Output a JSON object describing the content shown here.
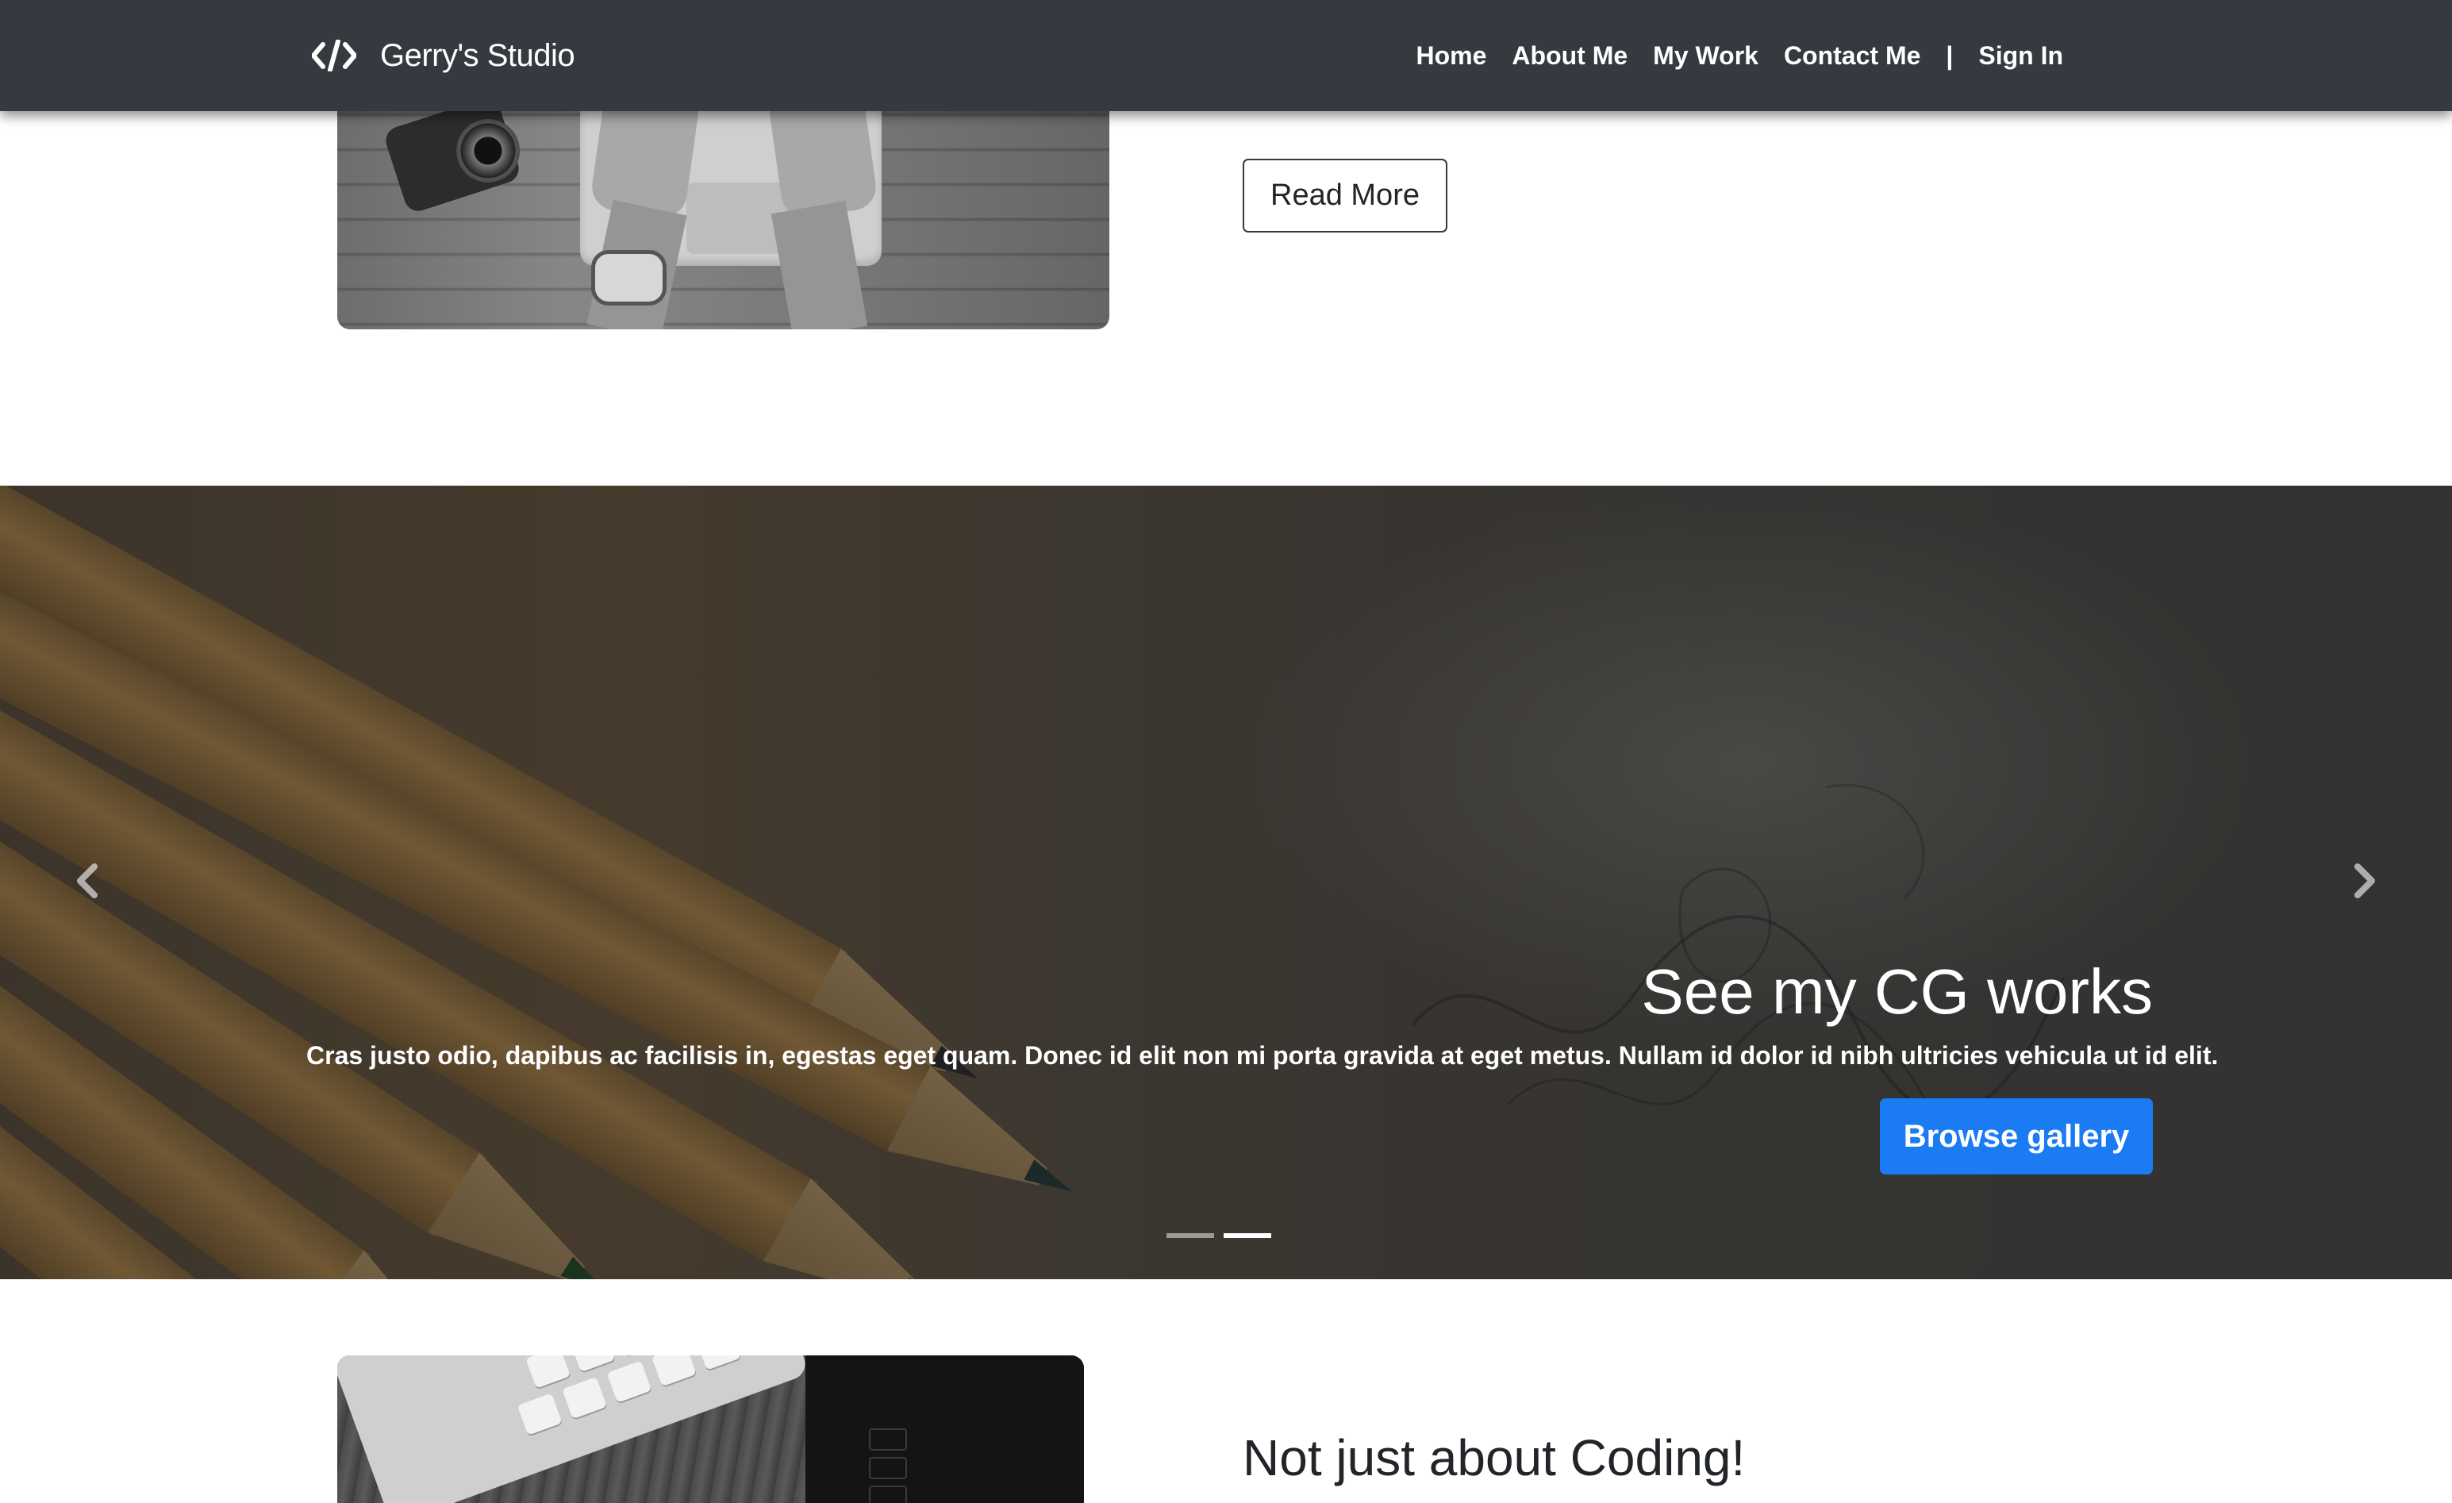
{
  "navbar": {
    "brand": "Gerry's Studio",
    "brand_icon": "code-icon",
    "links": [
      "Home",
      "About Me",
      "My Work",
      "Contact Me"
    ],
    "separator": "|",
    "sign_in": "Sign In",
    "background_color": "#343a40"
  },
  "featurette_top": {
    "image": "hands-typing-on-laptop-with-camera-photo",
    "button_label": "Read More"
  },
  "carousel": {
    "image": "colored-pencils-sketch-photo",
    "slide_title": "See my CG works",
    "slide_text": "Cras justo odio, dapibus ac facilisis in, egestas eget quam. Donec id elit non mi porta gravida at eget metus. Nullam id dolor id nibh ultricies vehicula ut id elit.",
    "button_label": "Browse gallery",
    "button_color": "#1a7bf3",
    "prev_icon": "chevron-left-icon",
    "next_icon": "chevron-right-icon",
    "indicator_count": 2,
    "active_indicator": 2
  },
  "featurette_bottom": {
    "image": "keyboard-and-drawing-tablet-photo",
    "heading": "Not just about Coding!"
  }
}
